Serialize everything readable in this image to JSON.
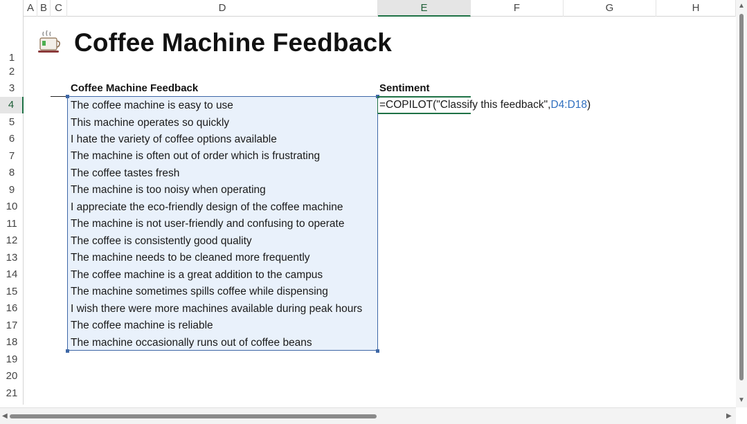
{
  "columns": [
    "A",
    "B",
    "C",
    "D",
    "E",
    "F",
    "G",
    "H"
  ],
  "selected_column": "E",
  "rows": [
    "1",
    "2",
    "3",
    "4",
    "5",
    "6",
    "7",
    "8",
    "9",
    "10",
    "11",
    "12",
    "13",
    "14",
    "15",
    "16",
    "17",
    "18",
    "19",
    "20",
    "21"
  ],
  "selected_row": "4",
  "title": "Coffee Machine Feedback",
  "title_icon": "coffee-cup-icon",
  "headers": {
    "feedback": "Coffee Machine Feedback",
    "sentiment": "Sentiment"
  },
  "feedback": [
    "The coffee machine is easy to use",
    "This machine operates so quickly",
    "I hate the variety of coffee options available",
    "The machine is often out of order which is frustrating",
    "The coffee tastes fresh",
    "The machine is too noisy when operating",
    "I appreciate the eco-friendly design of the coffee machine",
    "The machine is not user-friendly and confusing to operate",
    "The coffee is consistently good quality",
    "The machine needs to be cleaned more frequently",
    "The coffee machine is a great addition to the campus",
    "The machine sometimes spills coffee while dispensing",
    "I wish there were more machines available during peak hours",
    "The coffee machine is reliable",
    "The machine occasionally runs out of coffee beans"
  ],
  "formula": {
    "prefix": "=COPILOT(\"Classify this feedback\",",
    "ref": "D4:D18",
    "suffix": ")"
  },
  "colors": {
    "range_fill": "#e9f1fb",
    "range_border": "#3e67a6",
    "active_border": "#1e7145",
    "formula_ref": "#2f6fbf"
  }
}
